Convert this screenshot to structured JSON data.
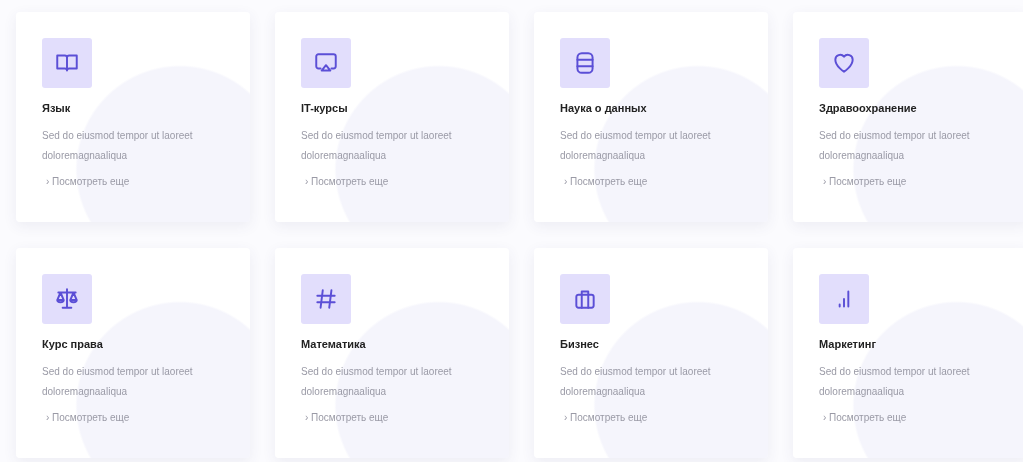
{
  "cards": [
    {
      "title": "Язык",
      "description": "Sed do eiusmod tempor ut laoreet doloremagnaaliqua",
      "link": "› Посмотреть еще"
    },
    {
      "title": "IT-курсы",
      "description": "Sed do eiusmod tempor ut laoreet doloremagnaaliqua",
      "link": "› Посмотреть еще"
    },
    {
      "title": "Наука о данных",
      "description": "Sed do eiusmod tempor ut laoreet doloremagnaaliqua",
      "link": "› Посмотреть еще"
    },
    {
      "title": "Здравоохранение",
      "description": "Sed do eiusmod tempor ut laoreet doloremagnaaliqua",
      "link": "› Посмотреть еще"
    },
    {
      "title": "Курс права",
      "description": "Sed do eiusmod tempor ut laoreet doloremagnaaliqua",
      "link": "› Посмотреть еще"
    },
    {
      "title": "Математика",
      "description": "Sed do eiusmod tempor ut laoreet doloremagnaaliqua",
      "link": "› Посмотреть еще"
    },
    {
      "title": "Бизнес",
      "description": "Sed do eiusmod tempor ut laoreet doloremagnaaliqua",
      "link": "› Посмотреть еще"
    },
    {
      "title": "Маркетинг",
      "description": "Sed do eiusmod tempor ut laoreet doloremagnaaliqua",
      "link": "› Посмотреть еще"
    }
  ]
}
